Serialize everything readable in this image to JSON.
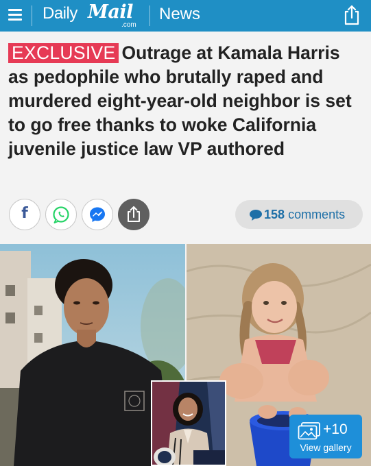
{
  "header": {
    "logo_daily": "Daily",
    "logo_mail": "Mail",
    "logo_com": ".com",
    "section": "News",
    "brand_color": "#1f8fc5"
  },
  "article": {
    "badge": "EXCLUSIVE",
    "badge_color": "#e63a55",
    "headline": "Outrage at Kamala Harris as pedophile who brutally raped and murdered eight-year-old neighbor is set to go free thanks to woke California juvenile justice law VP authored"
  },
  "social": {
    "buttons": [
      {
        "icon": "facebook-icon",
        "color": "#3b5998"
      },
      {
        "icon": "whatsapp-icon",
        "color": "#25d366"
      },
      {
        "icon": "messenger-icon",
        "color": "#1877f2"
      },
      {
        "icon": "share-icon",
        "color": "#5f5f5f"
      }
    ],
    "comments_count": "158",
    "comments_label": "comments"
  },
  "gallery": {
    "count": "+10",
    "label": "View gallery",
    "icon": "gallery-icon"
  }
}
